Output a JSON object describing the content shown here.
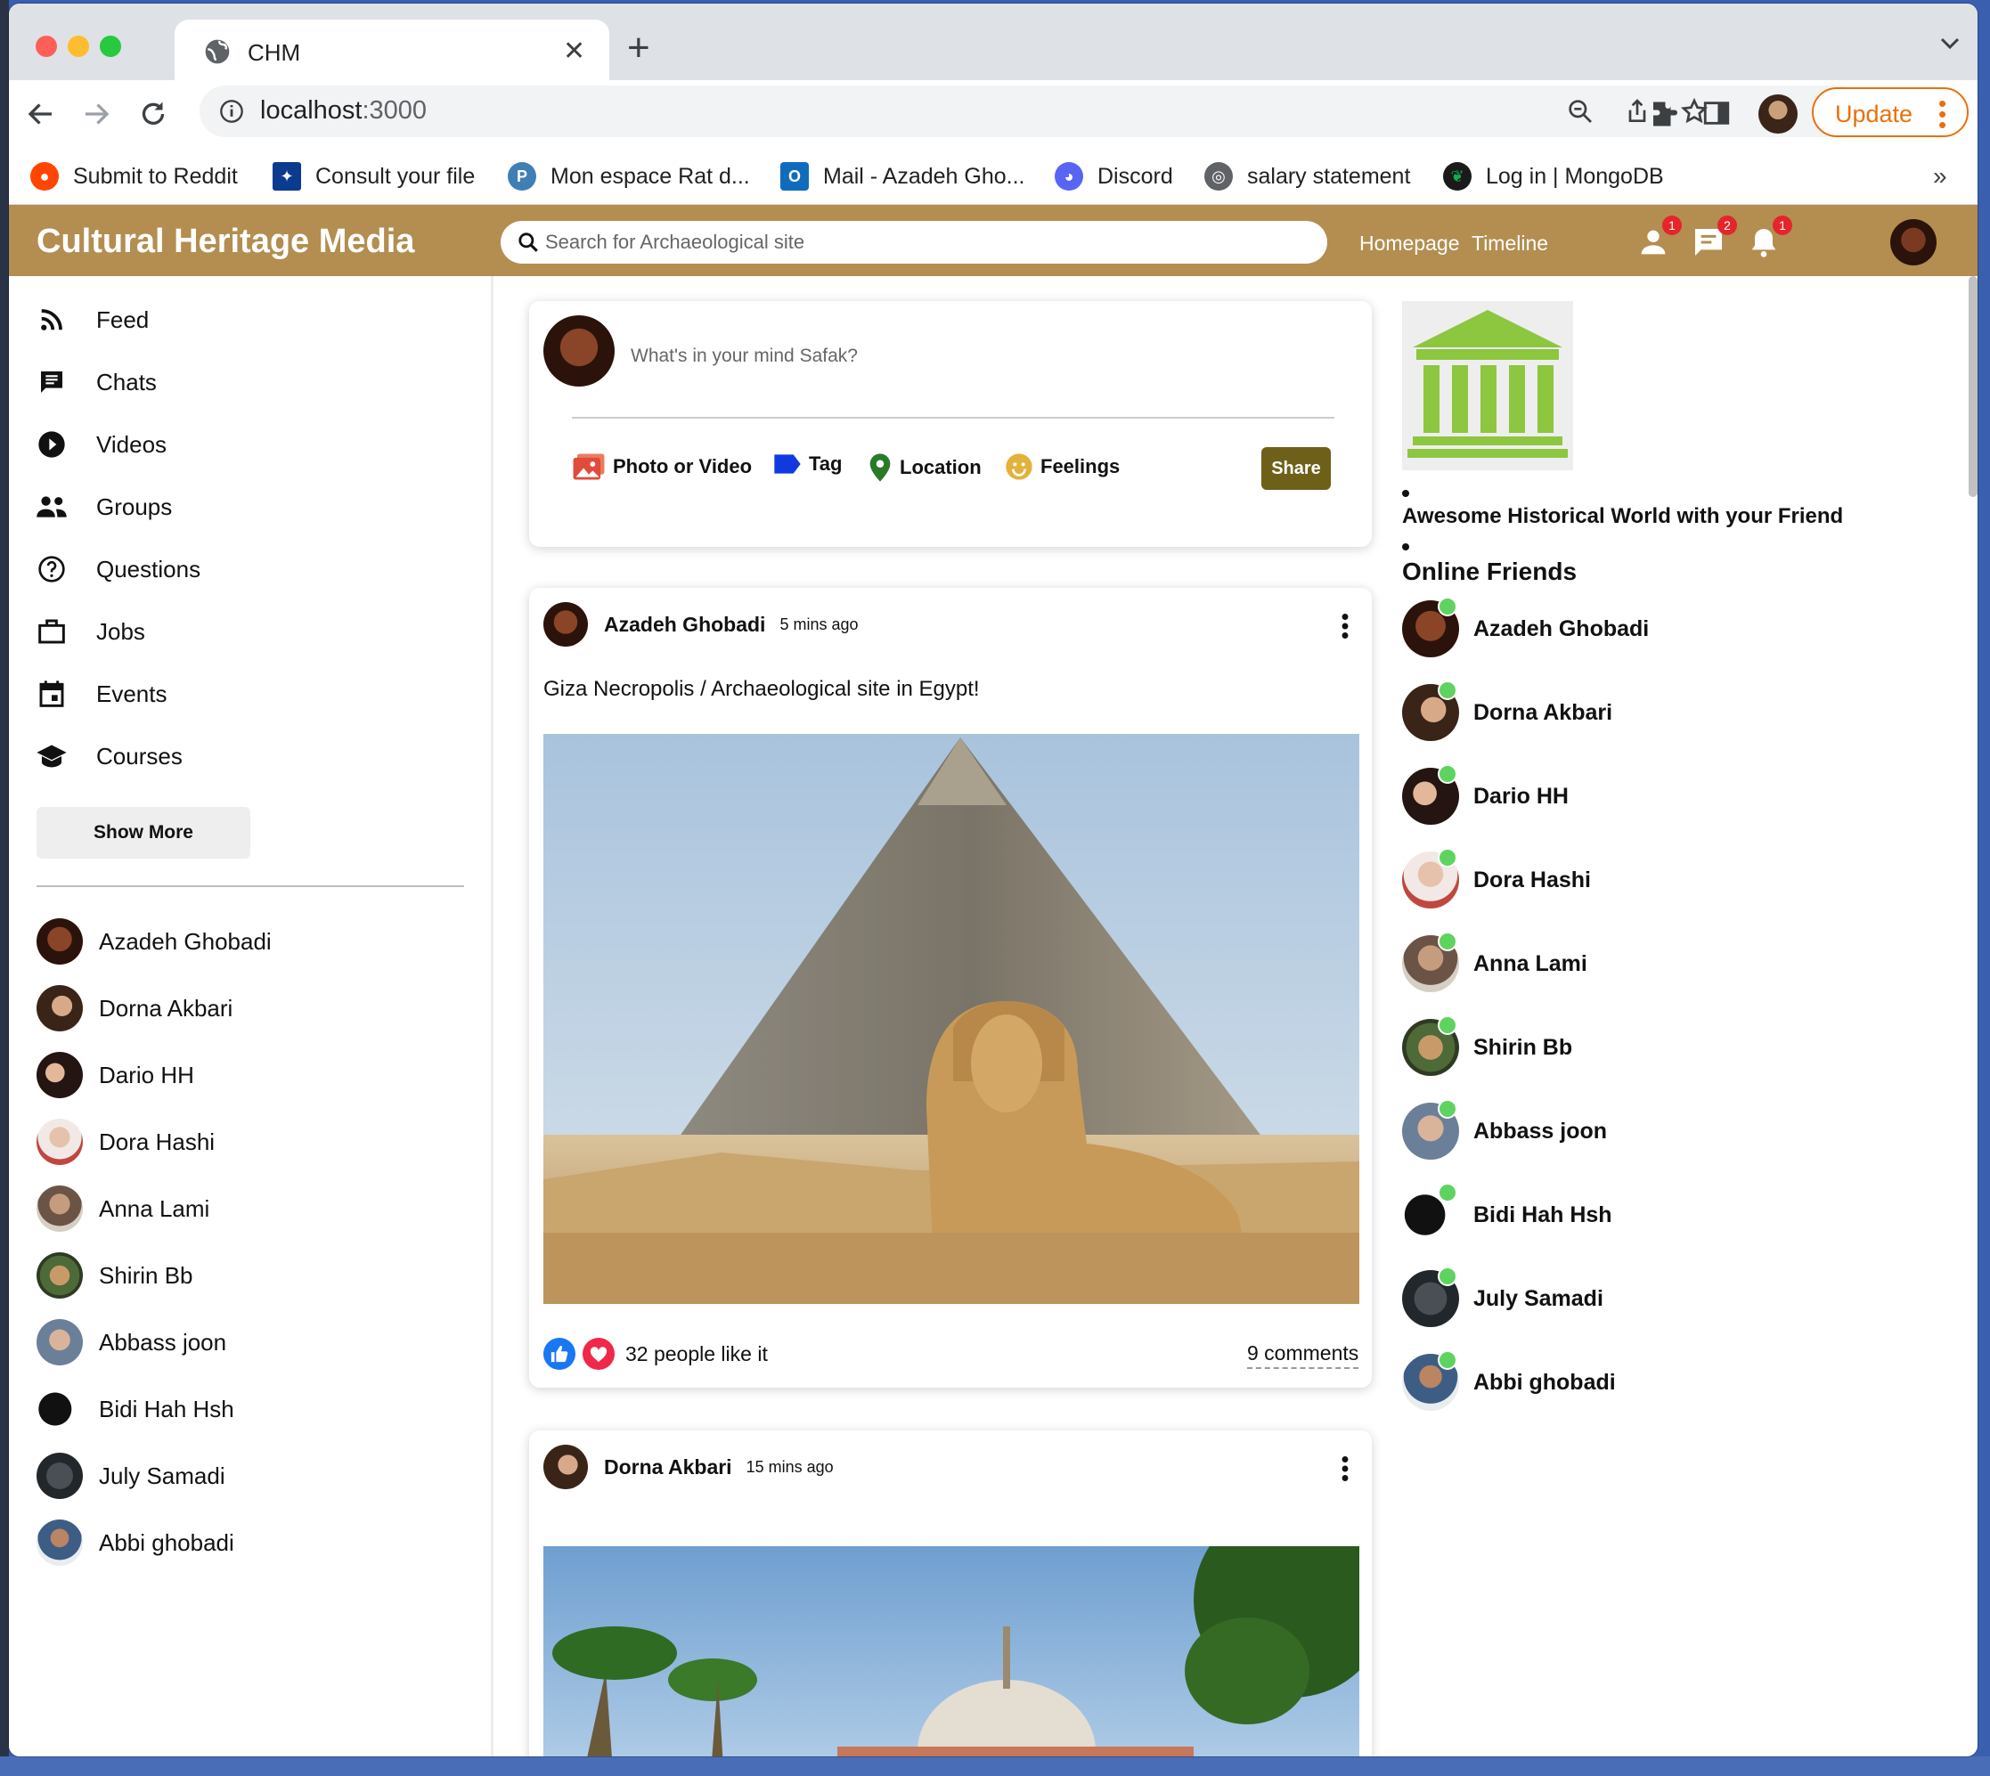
{
  "browser": {
    "tab_title": "CHM",
    "url_host": "localhost",
    "url_port": ":3000",
    "update_label": "Update",
    "bookmarks": [
      {
        "label": "Submit to Reddit",
        "icon": "reddit-icon",
        "color": "#ff4500"
      },
      {
        "label": "Consult your file",
        "icon": "quebec-flag-icon",
        "color": "#0a3b8f"
      },
      {
        "label": "Mon espace Rat d...",
        "icon": "p-icon",
        "color": "#3f7fb6"
      },
      {
        "label": "Mail - Azadeh Gho...",
        "icon": "outlook-icon",
        "color": "#0f6cbd"
      },
      {
        "label": "Discord",
        "icon": "discord-icon",
        "color": "#5865f2"
      },
      {
        "label": "salary statement",
        "icon": "globe-icon",
        "color": "#5f6368"
      },
      {
        "label": "Log in | MongoDB",
        "icon": "mongodb-icon",
        "color": "#13aa52"
      }
    ],
    "bookmarks_more": "»"
  },
  "header": {
    "brand": "Cultural Heritage Media",
    "search_placeholder": "Search for Archaeological site",
    "links": [
      "Homepage",
      "Timeline"
    ],
    "badges": {
      "friends": "1",
      "messages": "2",
      "notifications": "1"
    },
    "accent": "#b38e50"
  },
  "sidebar": {
    "items": [
      {
        "label": "Feed",
        "icon": "rss-feed-icon"
      },
      {
        "label": "Chats",
        "icon": "chat-icon"
      },
      {
        "label": "Videos",
        "icon": "play-circle-icon"
      },
      {
        "label": "Groups",
        "icon": "group-icon"
      },
      {
        "label": "Questions",
        "icon": "help-circle-icon"
      },
      {
        "label": "Jobs",
        "icon": "briefcase-icon"
      },
      {
        "label": "Events",
        "icon": "calendar-icon"
      },
      {
        "label": "Courses",
        "icon": "school-icon"
      }
    ],
    "show_more": "Show More",
    "friends": [
      "Azadeh Ghobadi",
      "Dorna Akbari",
      "Dario HH",
      "Dora Hashi",
      "Anna Lami",
      "Shirin Bb",
      "Abbass joon",
      "Bidi Hah Hsh",
      "July Samadi",
      "Abbi ghobadi"
    ]
  },
  "share": {
    "placeholder": "What's in your mind Safak?",
    "options": [
      "Photo or Video",
      "Tag",
      "Location",
      "Feelings"
    ],
    "share_label": "Share"
  },
  "posts": [
    {
      "author": "Azadeh Ghobadi",
      "time": "5 mins ago",
      "text": "Giza Necropolis / Archaeological site in Egypt!",
      "likes": "32 people like it",
      "comments": "9 comments"
    },
    {
      "author": "Dorna Akbari",
      "time": "15 mins ago"
    }
  ],
  "rightbar": {
    "tagline": "Awesome Historical World with your Friend",
    "online_title": "Online Friends",
    "online": [
      "Azadeh Ghobadi",
      "Dorna Akbari",
      "Dario HH",
      "Dora Hashi",
      "Anna Lami",
      "Shirin Bb",
      "Abbass joon",
      "Bidi Hah Hsh",
      "July Samadi",
      "Abbi ghobadi"
    ]
  }
}
